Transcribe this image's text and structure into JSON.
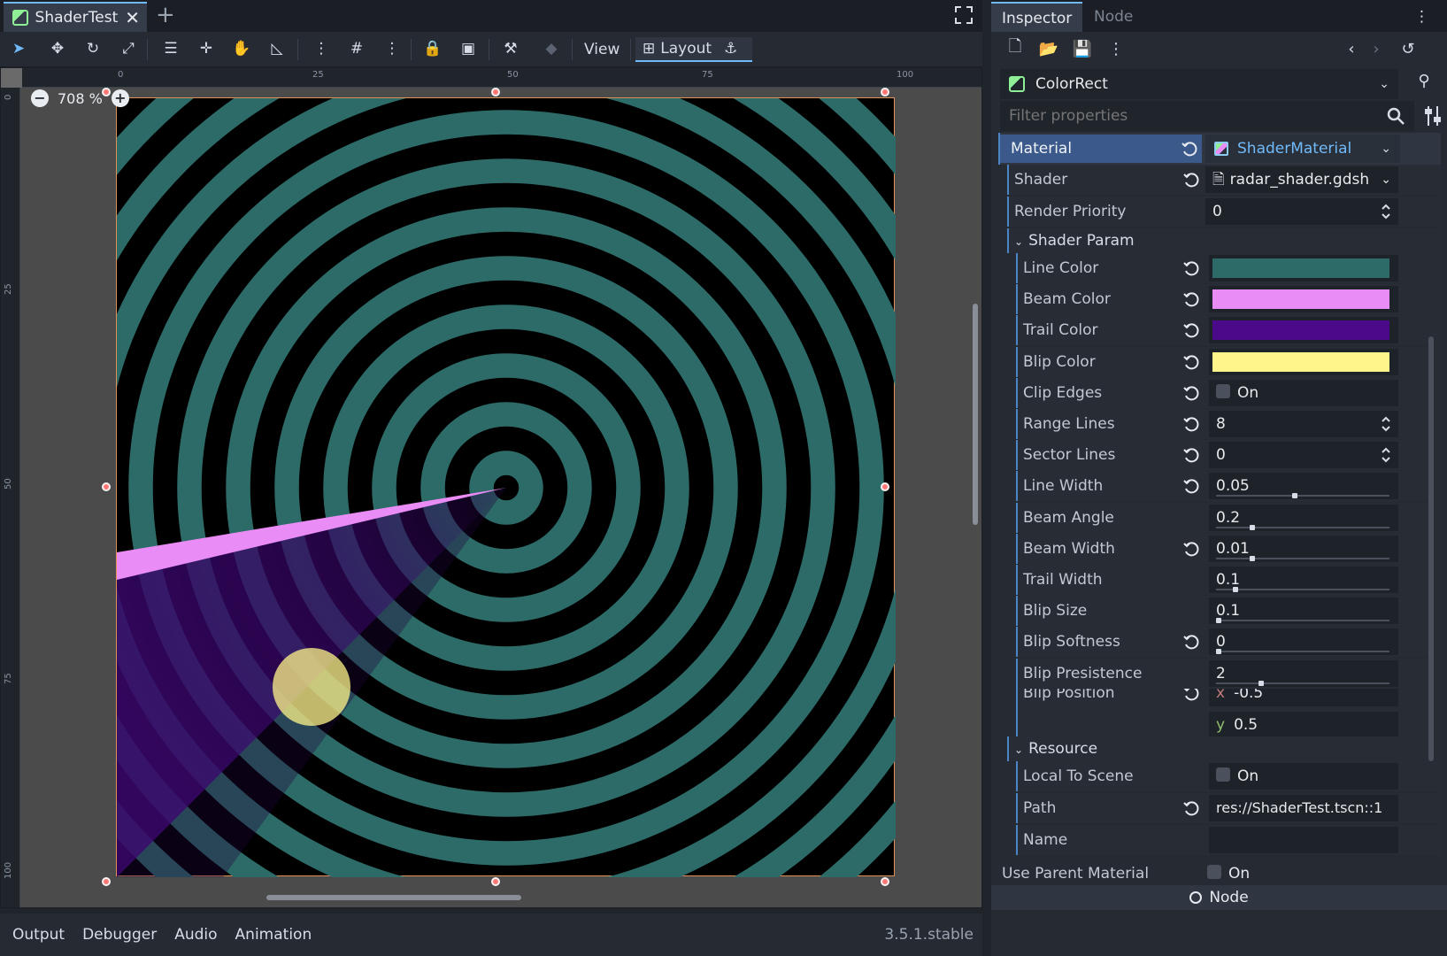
{
  "editor": {
    "scene_tab": "ShaderTest",
    "add_tab": "+",
    "close_tab": "✕",
    "toolbar": {
      "view_label": "View",
      "layout_label": "Layout"
    },
    "zoom": "708 %",
    "ruler_top_labels": [
      "0",
      "25",
      "50",
      "75",
      "100"
    ],
    "ruler_left_labels": [
      "0",
      "25",
      "50",
      "75",
      "100"
    ],
    "bottom_tabs": [
      "Output",
      "Debugger",
      "Audio",
      "Animation"
    ],
    "version": "3.5.1.stable"
  },
  "inspector": {
    "tabs": [
      "Inspector",
      "Node"
    ],
    "object_name": "ColorRect",
    "filter_placeholder": "Filter properties",
    "material": {
      "label": "Material",
      "value": "ShaderMaterial"
    },
    "shader": {
      "label": "Shader",
      "value": "radar_shader.gdsh"
    },
    "render_priority": {
      "label": "Render Priority",
      "value": "0"
    },
    "shader_param_section": "Shader Param",
    "params": [
      {
        "label": "Line Color",
        "type": "color",
        "color": "#2d6b69"
      },
      {
        "label": "Beam Color",
        "type": "color",
        "color": "#e98cf5"
      },
      {
        "label": "Trail Color",
        "type": "color",
        "color": "#4a0a8a"
      },
      {
        "label": "Blip Color",
        "type": "color",
        "color": "#fff58a"
      },
      {
        "label": "Clip Edges",
        "type": "check",
        "value": "On"
      },
      {
        "label": "Range Lines",
        "type": "spin",
        "value": "8"
      },
      {
        "label": "Sector Lines",
        "type": "spin",
        "value": "0"
      },
      {
        "label": "Line Width",
        "type": "slider",
        "value": "0.05",
        "fill": 0.45
      },
      {
        "label": "Beam Angle",
        "type": "slider",
        "value": "0.2",
        "fill": 0.2
      },
      {
        "label": "Beam Width",
        "type": "slider",
        "value": "0.01",
        "fill": 0.2
      },
      {
        "label": "Trail Width",
        "type": "slider",
        "value": "0.1",
        "fill": 0.1
      },
      {
        "label": "Blip Size",
        "type": "slider",
        "value": "0.1",
        "fill": 0.0
      },
      {
        "label": "Blip Softness",
        "type": "slider",
        "value": "0",
        "fill": 0.0
      },
      {
        "label": "Blip Presistence",
        "type": "slider",
        "value": "2",
        "fill": 0.25
      }
    ],
    "blip_position": {
      "label": "Blip Position",
      "x_label": "x",
      "x": "-0.5",
      "y_label": "y",
      "y": "0.5"
    },
    "resource_section": "Resource",
    "local_to_scene": {
      "label": "Local To Scene",
      "value": "On"
    },
    "path": {
      "label": "Path",
      "value": "res://ShaderTest.tscn::1"
    },
    "name": {
      "label": "Name",
      "value": ""
    },
    "use_parent_material": {
      "label": "Use Parent Material",
      "value": "On"
    },
    "node_section": "Node"
  },
  "colors": {
    "accent": "#70bafa",
    "ring": "#2d6b69",
    "beam": "#e98cf5",
    "trail": "#4a0a8a",
    "blip": "#fff58a"
  }
}
